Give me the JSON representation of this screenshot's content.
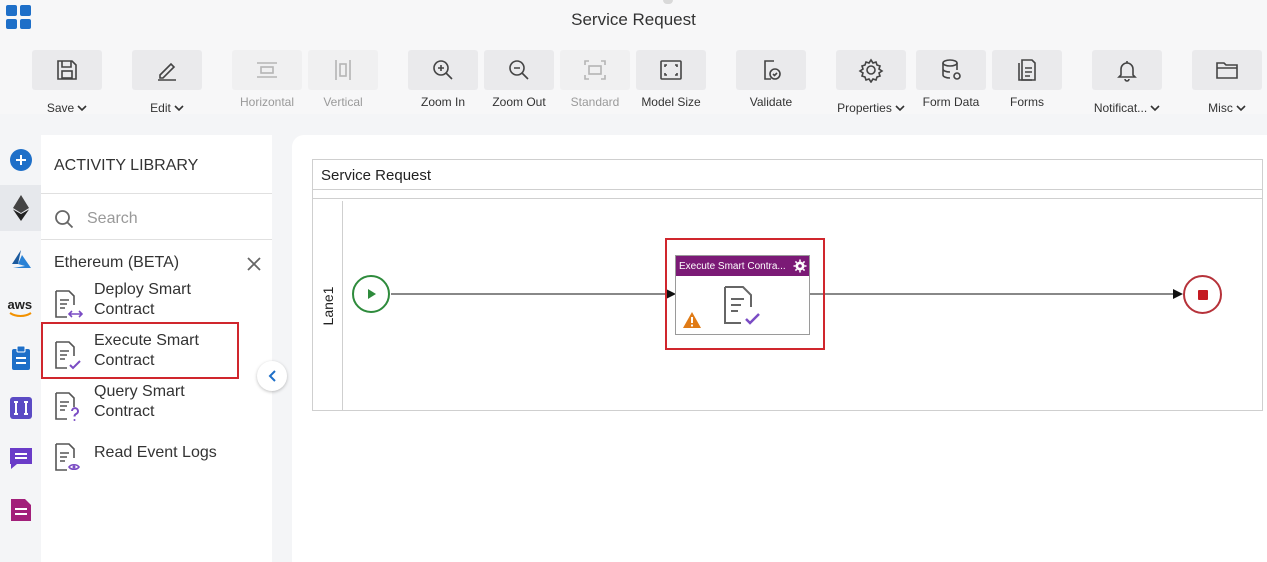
{
  "window": {
    "title": "Service Request"
  },
  "toolbar": {
    "save": "Save",
    "edit": "Edit",
    "horizontal": "Horizontal",
    "vertical": "Vertical",
    "zoom_in": "Zoom In",
    "zoom_out": "Zoom Out",
    "standard": "Standard",
    "model_size": "Model Size",
    "validate": "Validate",
    "properties": "Properties",
    "form_data": "Form Data",
    "forms": "Forms",
    "notifications": "Notificat...",
    "misc": "Misc"
  },
  "sidebar_rail": {
    "items": [
      "add-icon",
      "ethereum-icon",
      "azure-icon",
      "aws-icon",
      "clipboard-icon",
      "integration-icon",
      "chat-icon",
      "document-icon"
    ],
    "aws_label": "aws"
  },
  "library": {
    "heading": "ACTIVITY LIBRARY",
    "search_placeholder": "Search",
    "category": "Ethereum (BETA)",
    "items": [
      {
        "label": "Deploy Smart Contract"
      },
      {
        "label": "Execute Smart Contract"
      },
      {
        "label": "Query Smart Contract"
      },
      {
        "label": "Read Event Logs"
      }
    ]
  },
  "canvas": {
    "pool_title": "Service Request",
    "lane_label": "Lane1",
    "task_title": "Execute Smart Contra..."
  },
  "colors": {
    "accent_blue": "#1e6fc8",
    "task_header": "#7b1a76",
    "selection_red": "#d0262d",
    "start_green": "#2e8b3c",
    "end_red": "#b6323a",
    "warning_orange": "#e07b16",
    "purple_icon": "#7a4cc4"
  }
}
